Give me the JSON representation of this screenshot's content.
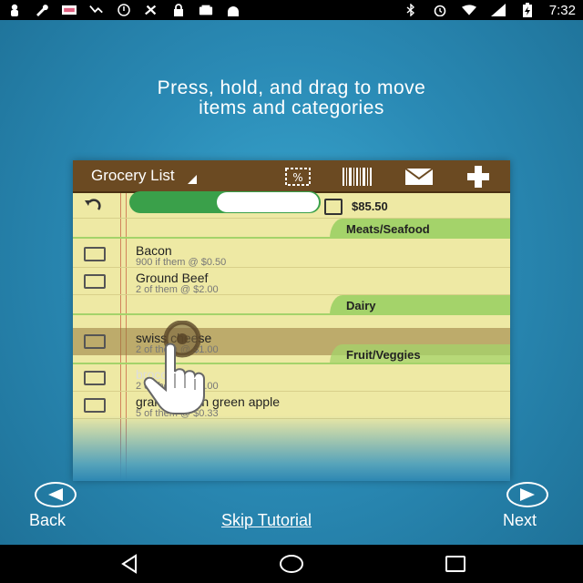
{
  "status_bar": {
    "time": "7:32",
    "left_icons": [
      "cat-icon",
      "wrench-icon",
      "keyboard-icon",
      "missed-call-icon",
      "alarm-off-icon",
      "tools-icon",
      "lock-icon",
      "tray-icon",
      "android-icon"
    ],
    "right_icons": [
      "bluetooth-icon",
      "alarm-icon",
      "wifi-icon",
      "signal-icon",
      "battery-charging-icon"
    ]
  },
  "tutorial": {
    "title": "Press, hold, and drag to move\nitems and categories"
  },
  "mock_app": {
    "toolbar_title": "Grocery List",
    "total": "$85.50",
    "categories": {
      "meats": "Meats/Seafood",
      "dairy": "Dairy",
      "fruit": "Fruit/Veggies"
    },
    "items": [
      {
        "name": "Bacon",
        "detail": "900 if them @ $0.50"
      },
      {
        "name": "Ground Beef",
        "detail": "2 of them @ $2.00"
      },
      {
        "name": "swiss cheese",
        "detail": "2 of them @ $1.00"
      },
      {
        "name": "broccoli",
        "detail": "2 of them @ $2.00"
      },
      {
        "name": "granny smith green apple",
        "detail": "5 of them @ $0.33"
      }
    ]
  },
  "nav": {
    "back": "Back",
    "skip": "Skip Tutorial",
    "next": "Next"
  },
  "colors": {
    "background": "#2a8ab5",
    "toolbar": "#6b4a22",
    "paper": "#eee9a4",
    "category": "#a4d36a"
  }
}
